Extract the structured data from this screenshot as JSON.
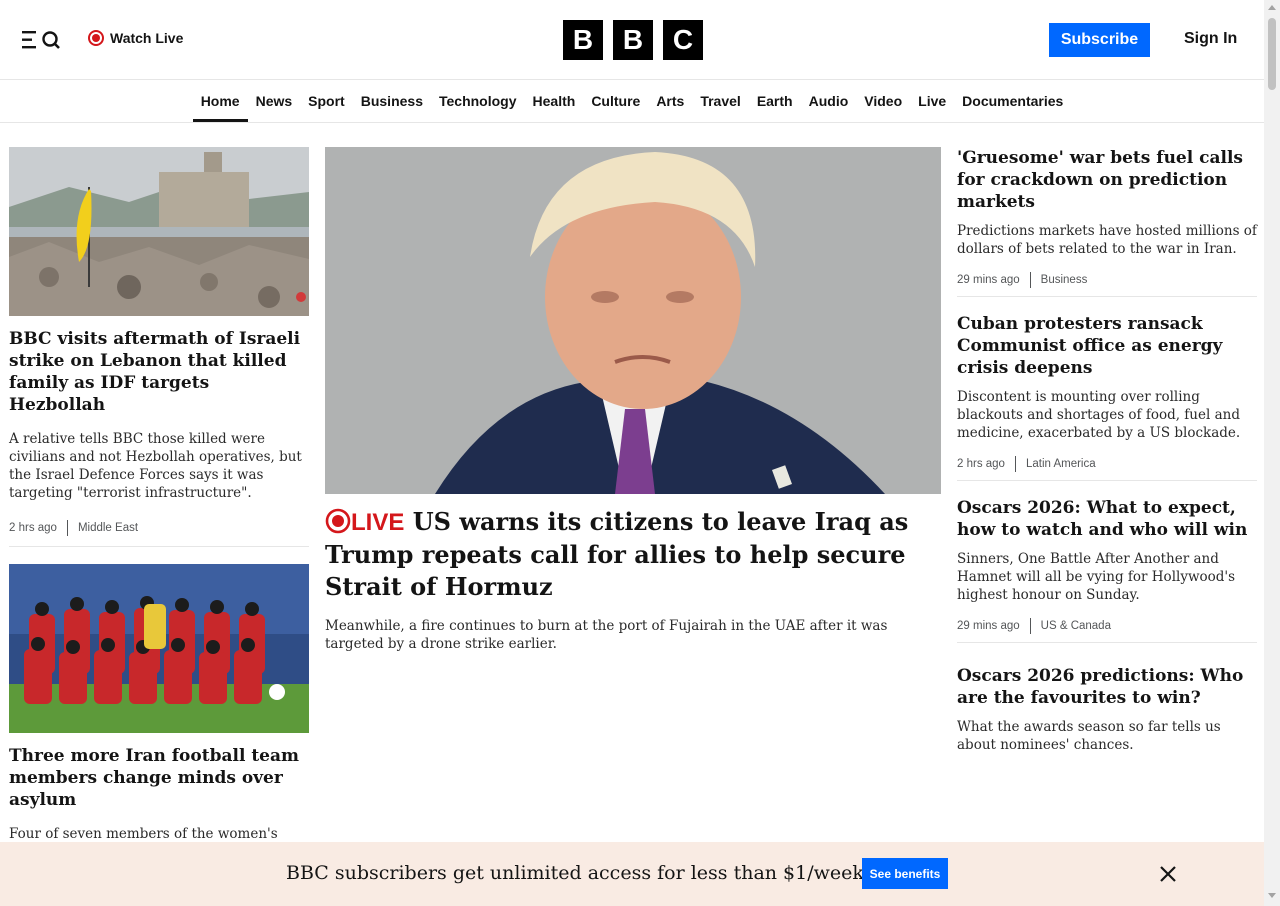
{
  "header": {
    "watch_live": "Watch Live",
    "logo_letters": [
      "B",
      "B",
      "C"
    ],
    "subscribe": "Subscribe",
    "sign_in": "Sign In"
  },
  "nav": {
    "items": [
      "Home",
      "News",
      "Sport",
      "Business",
      "Technology",
      "Health",
      "Culture",
      "Arts",
      "Travel",
      "Earth",
      "Audio",
      "Video",
      "Live",
      "Documentaries"
    ],
    "active": "Home"
  },
  "left": {
    "story1": {
      "headline": "BBC visits aftermath of Israeli strike on Lebanon that killed family as IDF targets Hezbollah",
      "summary": "A relative tells BBC those killed were civilians and not Hezbollah operatives, but the Israel Defence Forces says it was targeting \"terrorist infrastructure\".",
      "time": "2 hrs ago",
      "section": "Middle East"
    },
    "story2": {
      "headline": "Three more Iran football team members change minds over asylum",
      "summary": "Four of seven members of the women's football delegation who originally sought to"
    }
  },
  "center": {
    "live_label": "LIVE",
    "headline": "US warns its citizens to leave Iraq as Trump repeats call for allies to help secure Strait of Hormuz",
    "summary": "Meanwhile, a fire continues to burn at the port of Fujairah in the UAE after it was targeted by a drone strike earlier."
  },
  "right": {
    "stories": [
      {
        "headline": "'Gruesome' war bets fuel calls for crackdown on prediction markets",
        "summary": "Predictions markets have hosted millions of dollars of bets related to the war in Iran.",
        "time": "29 mins ago",
        "section": "Business"
      },
      {
        "headline": "Cuban protesters ransack Communist office as energy crisis deepens",
        "summary": "Discontent is mounting over rolling blackouts and shortages of food, fuel and medicine, exacerbated by a US blockade.",
        "time": "2 hrs ago",
        "section": "Latin America"
      },
      {
        "headline": "Oscars 2026: What to expect, how to watch and who will win",
        "summary": "Sinners, One Battle After Another and Hamnet will all be vying for Hollywood's highest honour on Sunday.",
        "time": "29 mins ago",
        "section": "US & Canada"
      },
      {
        "headline": "Oscars 2026 predictions: Who are the favourites to win?",
        "summary": "What the awards season so far tells us about nominees' chances."
      }
    ]
  },
  "banner": {
    "text": "BBC subscribers get unlimited access for less than $1/week",
    "button": "See benefits"
  },
  "colors": {
    "accent_blue": "#0068ff",
    "live_red": "#d4171b",
    "banner_bg": "#f9ebe3"
  }
}
